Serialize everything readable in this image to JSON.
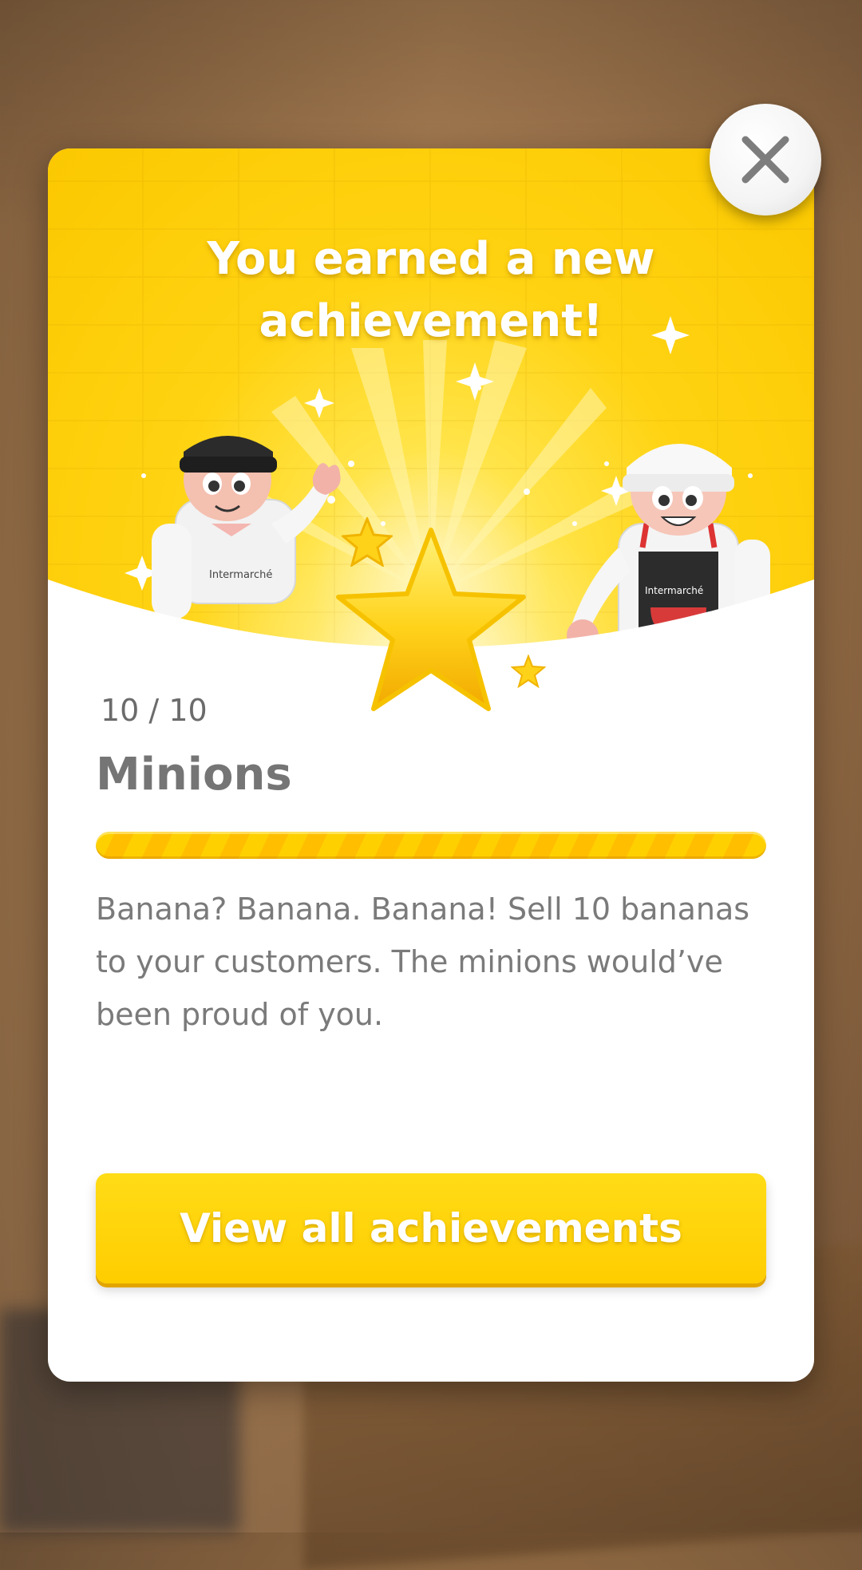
{
  "modal": {
    "headline": "You earned a new achievement!",
    "progress_text": "10 / 10",
    "progress": {
      "current": 10,
      "total": 10
    },
    "title": "Minions",
    "description": "Banana? Banana. Banana! Sell 10 bananas to your customers. The minions would’ve been proud of you.",
    "cta_label": "View all achievements",
    "left_figure_logo": "Intermarché",
    "right_figure_logo": "Intermarché"
  },
  "colors": {
    "accent_yellow": "#ffd000",
    "text_gray": "#757575",
    "modal_bg": "#ffffff"
  },
  "icons": {
    "close": "close-icon",
    "star": "star-icon"
  }
}
